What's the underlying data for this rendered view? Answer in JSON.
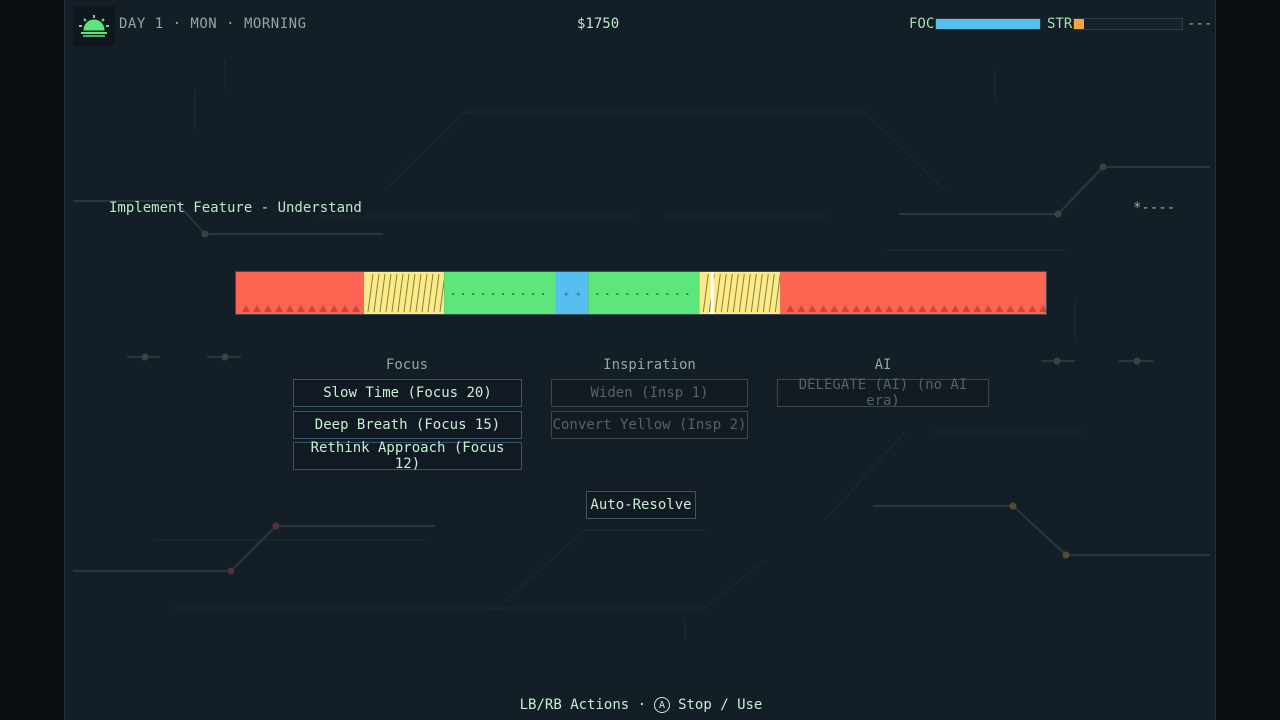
{
  "hud": {
    "day_label": "DAY 1 · MON · MORNING",
    "money": "$1750",
    "focus_label": "FOC",
    "focus_level": 1.0,
    "stress_label": "STR",
    "stress_level": 0.09,
    "right_marker": "---"
  },
  "task": {
    "title": "Implement Feature - Understand",
    "progress_marker": "*----"
  },
  "timing_bar": {
    "zones": [
      {
        "kind": "fail",
        "color": "#ff6352",
        "start": 0.0,
        "end": 0.158
      },
      {
        "kind": "partial",
        "color": "#fbea8a",
        "start": 0.158,
        "end": 0.257
      },
      {
        "kind": "good",
        "color": "#5fe67a",
        "start": 0.257,
        "end": 0.395
      },
      {
        "kind": "perfect",
        "color": "#56bff0",
        "start": 0.395,
        "end": 0.435
      },
      {
        "kind": "good",
        "color": "#5fe67a",
        "start": 0.435,
        "end": 0.572
      },
      {
        "kind": "partial",
        "color": "#fbea8a",
        "start": 0.572,
        "end": 0.672
      },
      {
        "kind": "fail",
        "color": "#ff6352",
        "start": 0.672,
        "end": 1.0
      }
    ],
    "cursor_position": 0.588
  },
  "columns": [
    {
      "title": "Focus",
      "actions": [
        {
          "label": "Slow Time (Focus 20)",
          "enabled": true
        },
        {
          "label": "Deep Breath (Focus 15)",
          "enabled": true
        },
        {
          "label": "Rethink Approach (Focus 12)",
          "enabled": true
        }
      ]
    },
    {
      "title": "Inspiration",
      "actions": [
        {
          "label": "Widen (Insp 1)",
          "enabled": false
        },
        {
          "label": "Convert Yellow (Insp 2)",
          "enabled": false
        }
      ]
    },
    {
      "title": "AI",
      "actions": [
        {
          "label": "DELEGATE (AI) (no AI era)",
          "enabled": false
        }
      ]
    }
  ],
  "auto_resolve_label": "Auto-Resolve",
  "footer": {
    "actions_hint": "LB/RB Actions ·",
    "button_glyph": "A",
    "use_hint": "Stop / Use"
  }
}
